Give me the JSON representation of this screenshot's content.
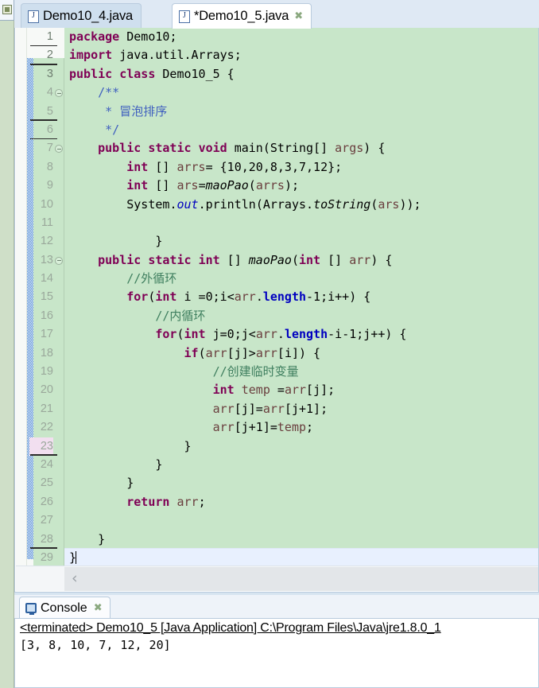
{
  "app": {
    "left_view_stub_icon": "package-explorer-icon"
  },
  "editor": {
    "tabs": [
      {
        "label": "Demo10_4.java",
        "icon": "java-file-icon",
        "active": false,
        "dirty": false
      },
      {
        "label": "*Demo10_5.java",
        "icon": "java-file-icon",
        "active": true,
        "dirty": true,
        "close": "✖"
      }
    ],
    "scrollbar": {
      "left_arrow": "‹"
    },
    "lines": [
      {
        "n": "1",
        "fold": false,
        "hl": false,
        "underline": true,
        "cur": false
      },
      {
        "n": "2",
        "fold": false,
        "hl": false,
        "underline": true,
        "cur": false
      },
      {
        "n": "3",
        "fold": false,
        "hl": false,
        "underline": false,
        "cur": false
      },
      {
        "n": "4",
        "fold": true,
        "hl": false,
        "underline": false,
        "cur": false
      },
      {
        "n": "5",
        "fold": false,
        "hl": false,
        "underline": true,
        "cur": false
      },
      {
        "n": "6",
        "fold": false,
        "hl": false,
        "underline": true,
        "cur": false
      },
      {
        "n": "7",
        "fold": true,
        "hl": false,
        "underline": false,
        "cur": false
      },
      {
        "n": "8",
        "fold": false,
        "hl": false,
        "underline": false,
        "cur": false
      },
      {
        "n": "9",
        "fold": false,
        "hl": false,
        "underline": false,
        "cur": false
      },
      {
        "n": "10",
        "fold": false,
        "hl": false,
        "underline": false,
        "cur": false
      },
      {
        "n": "11",
        "fold": false,
        "hl": false,
        "underline": false,
        "cur": false
      },
      {
        "n": "12",
        "fold": false,
        "hl": false,
        "underline": false,
        "cur": false
      },
      {
        "n": "13",
        "fold": true,
        "hl": false,
        "underline": false,
        "cur": false
      },
      {
        "n": "14",
        "fold": false,
        "hl": false,
        "underline": false,
        "cur": false
      },
      {
        "n": "15",
        "fold": false,
        "hl": false,
        "underline": false,
        "cur": false
      },
      {
        "n": "16",
        "fold": false,
        "hl": false,
        "underline": false,
        "cur": false
      },
      {
        "n": "17",
        "fold": false,
        "hl": false,
        "underline": false,
        "cur": false
      },
      {
        "n": "18",
        "fold": false,
        "hl": false,
        "underline": false,
        "cur": false
      },
      {
        "n": "19",
        "fold": false,
        "hl": false,
        "underline": false,
        "cur": false
      },
      {
        "n": "20",
        "fold": false,
        "hl": false,
        "underline": false,
        "cur": false
      },
      {
        "n": "21",
        "fold": false,
        "hl": false,
        "underline": false,
        "cur": false
      },
      {
        "n": "22",
        "fold": false,
        "hl": false,
        "underline": false,
        "cur": false
      },
      {
        "n": "23",
        "fold": false,
        "hl": true,
        "underline": true,
        "cur": false
      },
      {
        "n": "24",
        "fold": false,
        "hl": false,
        "underline": false,
        "cur": false
      },
      {
        "n": "25",
        "fold": false,
        "hl": false,
        "underline": false,
        "cur": false
      },
      {
        "n": "26",
        "fold": false,
        "hl": false,
        "underline": false,
        "cur": false
      },
      {
        "n": "27",
        "fold": false,
        "hl": false,
        "underline": false,
        "cur": false
      },
      {
        "n": "28",
        "fold": false,
        "hl": false,
        "underline": true,
        "cur": false
      },
      {
        "n": "29",
        "fold": false,
        "hl": false,
        "underline": true,
        "cur": true
      }
    ],
    "code_text": [
      "package Demo10;",
      "import java.util.Arrays;",
      "public class Demo10_5 {",
      "    /**",
      "     * 冒泡排序",
      "     */",
      "    public static void main(String[] args) {",
      "        int [] arrs= {10,20,8,3,7,12};",
      "        int [] ars=maoPao(arrs);",
      "        System.out.println(Arrays.toString(ars));",
      "",
      "            }",
      "    public static int [] maoPao(int [] arr) {",
      "        //外循环",
      "        for(int i =0;i<arr.length-1;i++) {",
      "            //内循环",
      "            for(int j=0;j<arr.length-i-1;j++) {",
      "                if(arr[j]>arr[i]) {",
      "                    //创建临时变量",
      "                    int temp =arr[j];",
      "                    arr[j]=arr[j+1];",
      "                    arr[j+1]=temp;",
      "                }",
      "            }",
      "        }",
      "        return arr;",
      "",
      "    }",
      "}"
    ]
  },
  "console": {
    "tab_label": "Console",
    "tab_icon": "console-monitor-icon",
    "close": "✖",
    "header": "<terminated> Demo10_5 [Java Application] C:\\Program Files\\Java\\jre1.8.0_1",
    "output": "[3, 8, 10, 7, 12, 20]"
  },
  "colors": {
    "editor_bg": "#c8e6c9",
    "current_line": "#e8f0fe",
    "keyword": "#7f0055",
    "javadoc": "#3f5fbf",
    "comment": "#3f7f5f",
    "field": "#0000c0",
    "parameter": "#6a3e3e",
    "change_bar": "#3f7fd0",
    "line_hl": "#f2dff0"
  }
}
